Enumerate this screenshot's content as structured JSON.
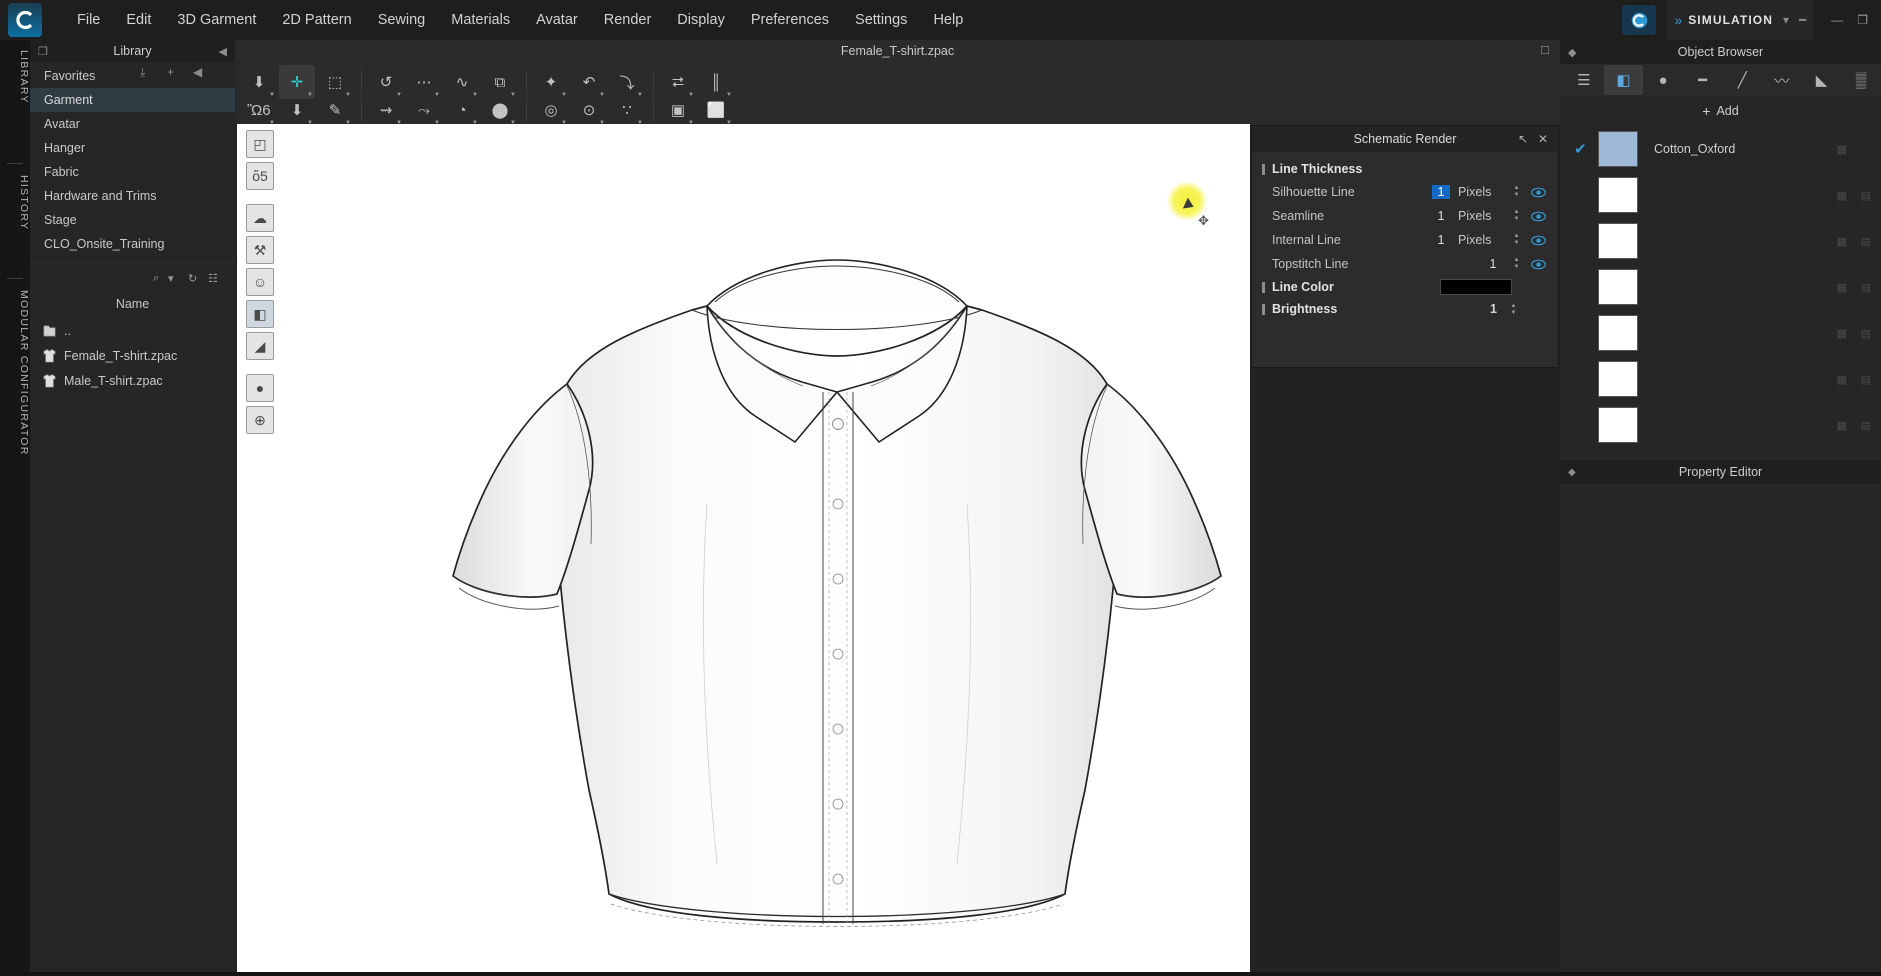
{
  "app": {
    "logo_glyph": "C",
    "document_title": "Female_T-shirt.zpac"
  },
  "menu": {
    "items": [
      {
        "label": "File"
      },
      {
        "label": "Edit"
      },
      {
        "label": "3D Garment"
      },
      {
        "label": "2D Pattern"
      },
      {
        "label": "Sewing"
      },
      {
        "label": "Materials"
      },
      {
        "label": "Avatar"
      },
      {
        "label": "Render"
      },
      {
        "label": "Display"
      },
      {
        "label": "Preferences"
      },
      {
        "label": "Settings"
      },
      {
        "label": "Help"
      }
    ]
  },
  "topbar": {
    "sync_icon": "clo-cloud-icon",
    "simulation_label": "SIMULATION",
    "simulation_chevron": "»",
    "dropdown_icon": "▾",
    "minimize": "—",
    "restore": "❐"
  },
  "rail": {
    "tabs": [
      {
        "label": "LIBRARY"
      },
      {
        "label": "HISTORY"
      },
      {
        "label": "MODULAR CONFIGURATOR"
      }
    ]
  },
  "library": {
    "title": "Library",
    "header_icons": {
      "popout": "❐",
      "collapse": "◀"
    },
    "tool_icons": {
      "import": "⤓",
      "add": "+",
      "back": "◀"
    },
    "categories": [
      {
        "label": "Favorites",
        "selected": false
      },
      {
        "label": "Garment",
        "selected": true
      },
      {
        "label": "Avatar",
        "selected": false
      },
      {
        "label": "Hanger",
        "selected": false
      },
      {
        "label": "Fabric",
        "selected": false
      },
      {
        "label": "Hardware and Trims",
        "selected": false
      },
      {
        "label": "Stage",
        "selected": false
      },
      {
        "label": "CLO_Onsite_Training",
        "selected": false
      }
    ],
    "search_icons": {
      "search": "⌕",
      "caret": "▾",
      "refresh": "↻",
      "grid": "☷"
    },
    "column_header": "Name",
    "files": [
      {
        "label": "..",
        "icon": "folder-icon"
      },
      {
        "label": "Female_T-shirt.zpac",
        "icon": "garment-icon"
      },
      {
        "label": "Male_T-shirt.zpac",
        "icon": "garment-icon"
      }
    ]
  },
  "toolbar": {
    "row1": [
      {
        "name": "select-mesh-tool",
        "glyph": "⬇"
      },
      {
        "name": "transform-garment-tool",
        "glyph": "✛",
        "active": true
      },
      {
        "name": "box-select-tool",
        "glyph": "⬚"
      },
      {
        "name": "fold-arrangement-tool",
        "glyph": "↺"
      },
      {
        "name": "segment-tool",
        "glyph": "⋯"
      },
      {
        "name": "curve-tool",
        "glyph": "∿"
      },
      {
        "name": "pattern-tool",
        "glyph": "⧉"
      },
      {
        "name": "pin-tool",
        "glyph": "✦"
      },
      {
        "name": "tack-tool",
        "glyph": "↶"
      },
      {
        "name": "flatten-tool",
        "glyph": "⤵"
      },
      {
        "name": "symmetric-tool",
        "glyph": "⮂"
      },
      {
        "name": "zipper-tool",
        "glyph": "║"
      }
    ],
    "row2": [
      {
        "name": "avatar-pose-tool",
        "glyph": "Ὣ6"
      },
      {
        "name": "gravity-tool",
        "glyph": "⬇"
      },
      {
        "name": "brush-tool",
        "glyph": "✎"
      },
      {
        "name": "fold-tool",
        "glyph": "⇝"
      },
      {
        "name": "unfold-tool",
        "glyph": "⤳"
      },
      {
        "name": "fabric-roll-tool",
        "glyph": "◔"
      },
      {
        "name": "button-tool",
        "glyph": "⬤"
      },
      {
        "name": "buttonhole-tool",
        "glyph": "◎"
      },
      {
        "name": "snap-tool",
        "glyph": "⊙"
      },
      {
        "name": "topstitch-tool",
        "glyph": "∵"
      },
      {
        "name": "trim-tool",
        "glyph": "▣"
      },
      {
        "name": "grading-tool",
        "glyph": "⬜"
      }
    ]
  },
  "viewport_tools": [
    {
      "name": "render-mode-tool",
      "glyph": "◰"
    },
    {
      "name": "garment-display-tool",
      "glyph": "ὅ5"
    },
    {
      "name": "fabric-texture-tool",
      "glyph": "☁"
    },
    {
      "name": "thickness-display-tool",
      "glyph": "⚒"
    },
    {
      "name": "avatar-display-tool",
      "glyph": "☺"
    },
    {
      "name": "show-stage-tool",
      "glyph": "◧",
      "active": true
    },
    {
      "name": "show-shadow-tool",
      "glyph": "◢"
    },
    {
      "name": "skin-offset-tool",
      "glyph": "●"
    },
    {
      "name": "environment-tool",
      "glyph": "⊕"
    }
  ],
  "cursor": {
    "arrow_icon": "pointer-arrow-icon",
    "move_icon": "move-handle-icon",
    "highlight_color": "#f3f03a"
  },
  "dialog": {
    "title": "Schematic Render",
    "pin_icon": "↖",
    "close_icon": "✕",
    "groups": {
      "line_thickness": "Line Thickness",
      "line_color": "Line Color",
      "brightness": "Brightness"
    },
    "rows": [
      {
        "label": "Silhouette Line",
        "value": "1",
        "unit": "Pixels",
        "highlighted": true,
        "visible": true
      },
      {
        "label": "Seamline",
        "value": "1",
        "unit": "Pixels",
        "highlighted": false,
        "visible": true
      },
      {
        "label": "Internal Line",
        "value": "1",
        "unit": "Pixels",
        "highlighted": false,
        "visible": true
      },
      {
        "label": "Topstitch Line",
        "value": "1",
        "unit": "",
        "highlighted": false,
        "visible": true
      }
    ],
    "line_color_hex": "#000000",
    "brightness_value": "1"
  },
  "object_browser": {
    "title": "Object Browser",
    "tabs": [
      {
        "name": "list-tab",
        "glyph": "☰",
        "selected": false
      },
      {
        "name": "fabric-tab",
        "glyph": "◧",
        "selected": true
      },
      {
        "name": "button-tab",
        "glyph": "●",
        "selected": false
      },
      {
        "name": "zipper-tab",
        "glyph": "━",
        "selected": false
      },
      {
        "name": "topstitch-tab",
        "glyph": "╱",
        "selected": false
      },
      {
        "name": "trim-tab",
        "glyph": "〰",
        "selected": false
      },
      {
        "name": "graphic-tab",
        "glyph": "◣",
        "selected": false
      },
      {
        "name": "grading-tab",
        "glyph": "▒",
        "selected": false
      }
    ],
    "add_label": "Add",
    "add_plus": "+",
    "items": [
      {
        "name": "Cotton_Oxford",
        "checked": true,
        "swatch": "#9fb8d8",
        "dim": false
      },
      {
        "name": "",
        "checked": false,
        "swatch": "#ffffff",
        "dim": true
      },
      {
        "name": "",
        "checked": false,
        "swatch": "#ffffff",
        "dim": true
      },
      {
        "name": "",
        "checked": false,
        "swatch": "#ffffff",
        "dim": true
      },
      {
        "name": "",
        "checked": false,
        "swatch": "#ffffff",
        "dim": true
      },
      {
        "name": "",
        "checked": false,
        "swatch": "#ffffff",
        "dim": true
      },
      {
        "name": "",
        "checked": false,
        "swatch": "#ffffff",
        "dim": true
      }
    ]
  },
  "property_editor": {
    "title": "Property Editor",
    "pin_icon": "◆"
  },
  "colors": {
    "accent": "#2e9ad6",
    "selection": "#1569c7",
    "panel_bg": "#262626",
    "header_bg": "#1f1f1f",
    "viewport_bg": "#ffffff"
  }
}
